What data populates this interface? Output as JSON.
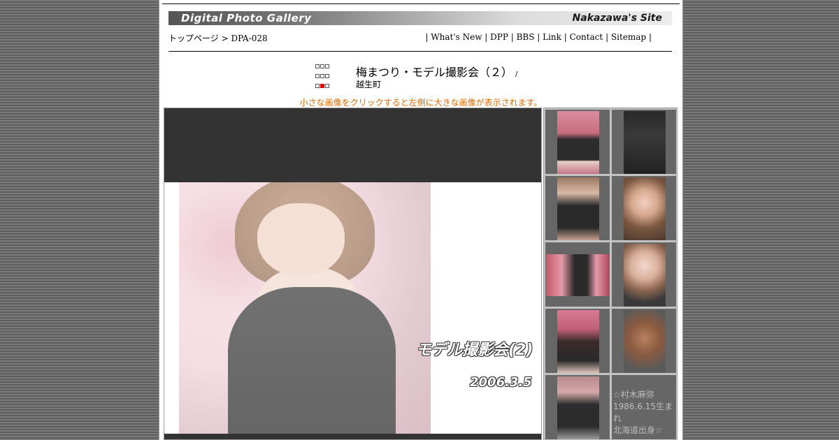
{
  "banner": {
    "left": "Digital Photo Gallery",
    "right": "Nakazawa's Site"
  },
  "breadcrumb": {
    "home": "トップページ",
    "sep": " > ",
    "current": "DPA-028"
  },
  "nav": [
    "| What's New | ",
    "DPP",
    " | ",
    "BBS",
    " | ",
    "Link",
    " | ",
    "Contact",
    " | ",
    "Sitemap",
    " |"
  ],
  "title": {
    "main": "梅まつり・モデル撮影会（２）",
    "sep": "/",
    "sub": "越生町"
  },
  "hint": "小さな画像をクリックすると左側に大きな画像が表示されます。",
  "main_image": {
    "caption1": "モデル撮影会(2)",
    "caption2": "2006.3.5"
  },
  "profile": {
    "line1": "☆村木麻弥",
    "line2": "1986.6.15生まれ",
    "line3": "北海道出身☆"
  }
}
